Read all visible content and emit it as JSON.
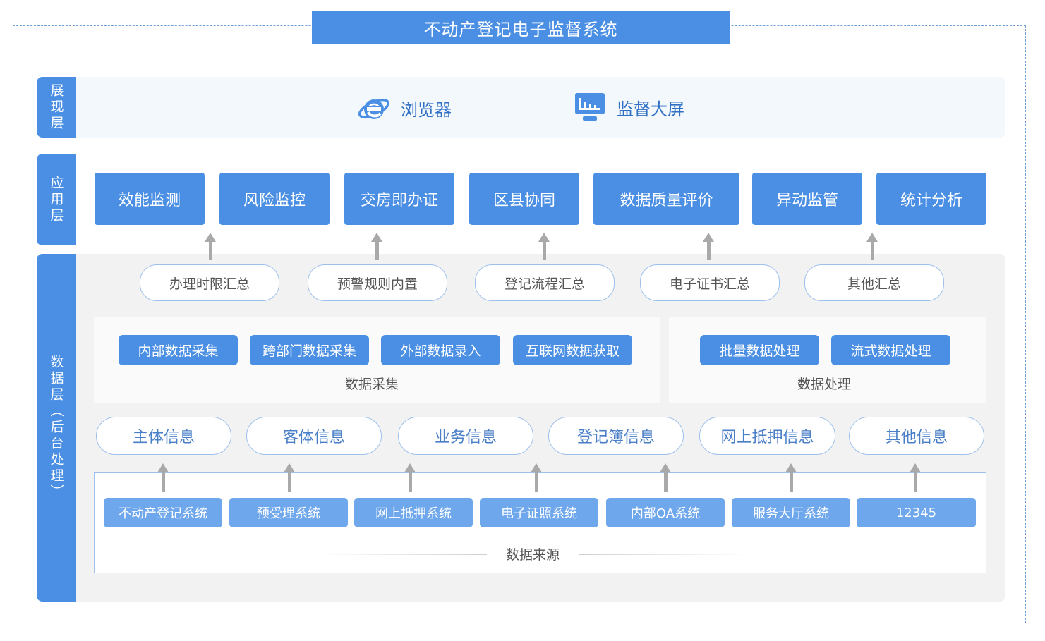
{
  "title": "不动产登记电子监督系统",
  "layers": {
    "presentation": {
      "label": "展现层",
      "items": [
        {
          "label": "浏览器",
          "icon": "ie-browser-icon"
        },
        {
          "label": "监督大屏",
          "icon": "monitor-screen-icon"
        }
      ]
    },
    "application": {
      "label": "应用层",
      "modules": [
        "效能监测",
        "风险监控",
        "交房即办证",
        "区县协同",
        "数据质量评价",
        "异动监管",
        "统计分析"
      ]
    },
    "data": {
      "label": "数据层（后台处理）",
      "summaries": [
        "办理时限汇总",
        "预警规则内置",
        "登记流程汇总",
        "电子证书汇总",
        "其他汇总"
      ],
      "collection": {
        "caption": "数据采集",
        "items": [
          "内部数据采集",
          "跨部门数据采集",
          "外部数据录入",
          "互联网数据获取"
        ]
      },
      "processing": {
        "caption": "数据处理",
        "items": [
          "批量数据处理",
          "流式数据处理"
        ]
      },
      "info_types": [
        "主体信息",
        "客体信息",
        "业务信息",
        "登记簿信息",
        "网上抵押信息",
        "其他信息"
      ],
      "sources": {
        "caption": "数据来源",
        "items": [
          "不动产登记系统",
          "预受理系统",
          "网上抵押系统",
          "电子证照系统",
          "内部OA系统",
          "服务大厅系统",
          "12345"
        ]
      }
    }
  },
  "colors": {
    "primary": "#4a8fe3",
    "light_button": "#6fa7ec",
    "band_light": "#f3f8fd",
    "band_gray": "#f2f2f2",
    "arrow": "#a9a9a9"
  }
}
